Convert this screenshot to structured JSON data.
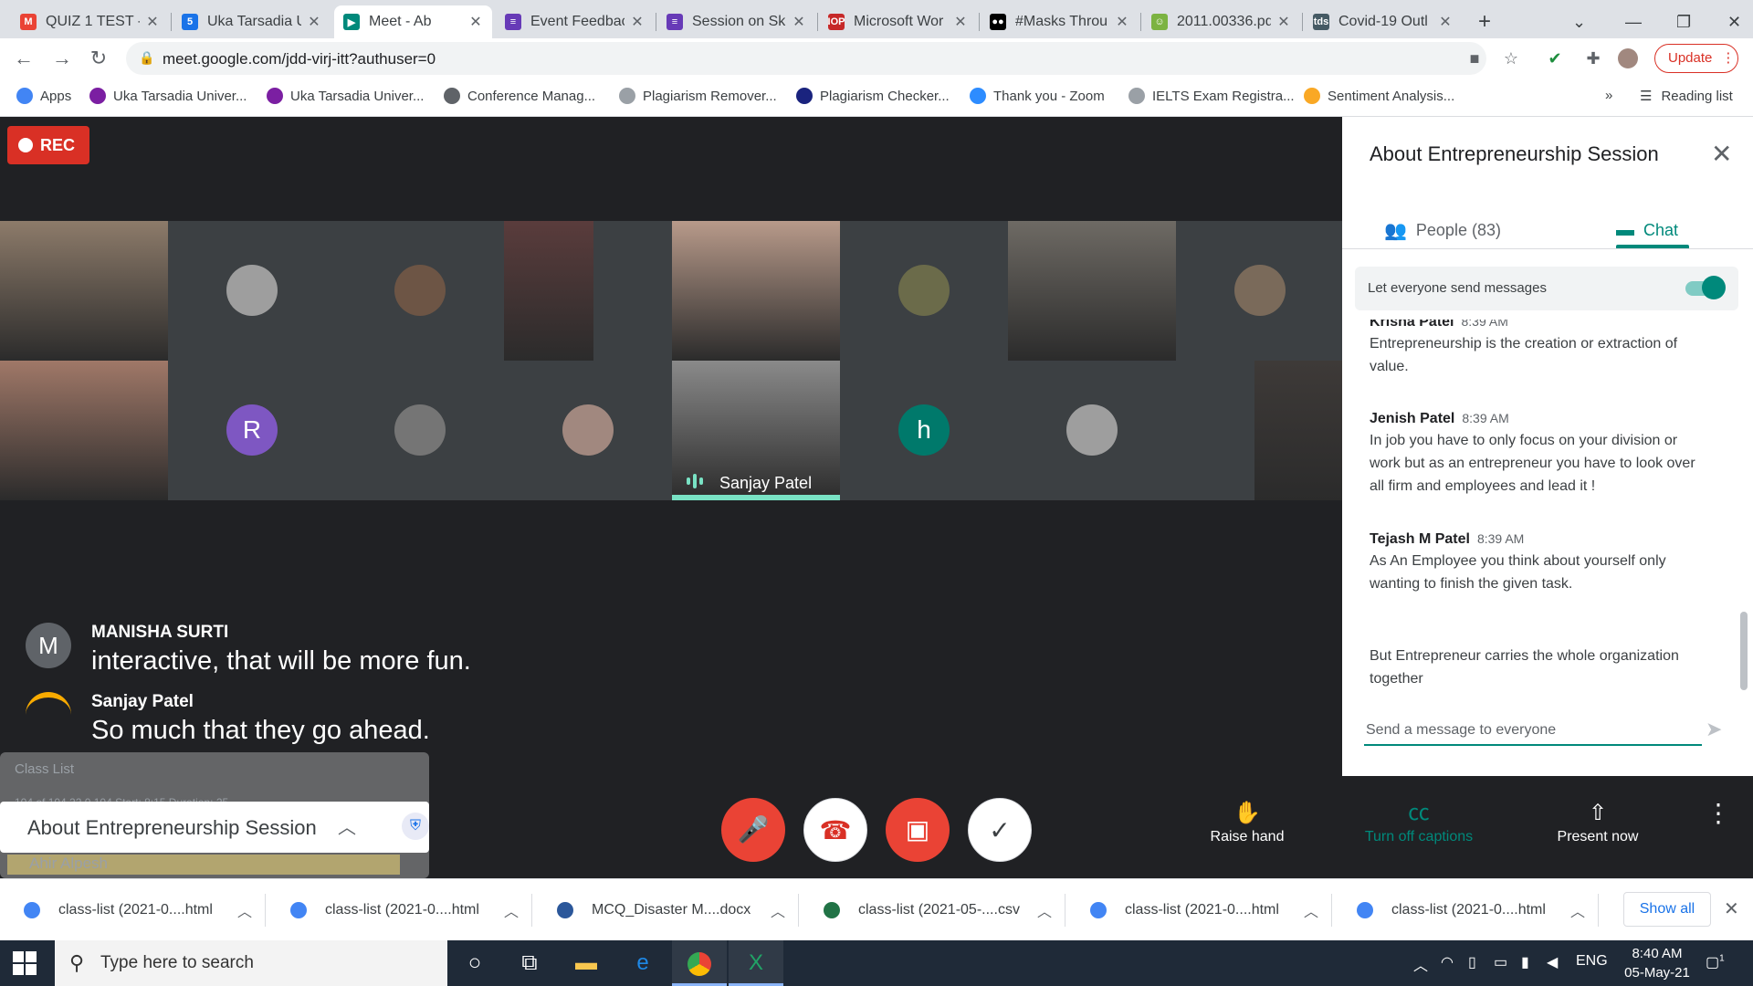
{
  "browser": {
    "tabs": [
      {
        "label": "QUIZ 1 TEST -",
        "icon": "gmail-icon",
        "color": "#ea4335",
        "glyph": "M"
      },
      {
        "label": "Uka Tarsadia U",
        "icon": "calendar-icon",
        "color": "#1a73e8",
        "glyph": "5"
      },
      {
        "label": "Meet - Ab",
        "icon": "meet-icon",
        "color": "#00897b",
        "glyph": "▶",
        "active": true
      },
      {
        "label": "Event Feedbac",
        "icon": "forms-icon",
        "color": "#673ab7",
        "glyph": "≡"
      },
      {
        "label": "Session on Ski",
        "icon": "forms-icon",
        "color": "#673ab7",
        "glyph": "≡"
      },
      {
        "label": "Microsoft Wor",
        "icon": "iop-icon",
        "color": "#c62828",
        "glyph": "IOP"
      },
      {
        "label": "#Masks Throu",
        "icon": "medium-icon",
        "color": "#000000",
        "glyph": "●●"
      },
      {
        "label": "2011.00336.pd",
        "icon": "smiley-icon",
        "color": "#7cb342",
        "glyph": "☺"
      },
      {
        "label": "Covid-19 Outl",
        "icon": "tds-icon",
        "color": "#455a64",
        "glyph": "tds"
      }
    ],
    "url": "meet.google.com/jdd-virj-itt?authuser=0",
    "update_label": "Update",
    "bookmarks": [
      {
        "label": "Apps",
        "color": "#4285f4"
      },
      {
        "label": "Uka Tarsadia Univer...",
        "color": "#7b1fa2"
      },
      {
        "label": "Uka Tarsadia Univer...",
        "color": "#7b1fa2"
      },
      {
        "label": "Conference Manag...",
        "color": "#5f6368"
      },
      {
        "label": "Plagiarism Remover...",
        "color": "#9aa0a6"
      },
      {
        "label": "Plagiarism Checker...",
        "color": "#1a237e"
      },
      {
        "label": "Thank you - Zoom",
        "color": "#2d8cff"
      },
      {
        "label": "IELTS Exam Registra...",
        "color": "#9aa0a6"
      },
      {
        "label": "Sentiment Analysis...",
        "color": "#f9a825"
      }
    ],
    "overflow_label": "»",
    "reading_list_label": "Reading list"
  },
  "meet": {
    "rec_label": "REC",
    "participants": [
      {
        "type": "video",
        "color": "#8d7b6a"
      },
      {
        "type": "avatar",
        "color": "#9e9e9e",
        "letter": ""
      },
      {
        "type": "avatar",
        "color": "#6d5545",
        "letter": ""
      },
      {
        "type": "video",
        "color": "#5a3c3c"
      },
      {
        "type": "video",
        "color": "#b89a8a"
      },
      {
        "type": "avatar",
        "color": "#6b6b4a",
        "letter": ""
      },
      {
        "type": "video",
        "color": "#6e6a64"
      },
      {
        "type": "avatar",
        "color": "#7a6a5a",
        "letter": ""
      },
      {
        "type": "video",
        "color": "#a07868"
      },
      {
        "type": "avatar",
        "color": "#7e57c2",
        "letter": "R"
      },
      {
        "type": "avatar",
        "color": "#757575",
        "letter": ""
      },
      {
        "type": "avatar",
        "color": "#a1887f",
        "letter": ""
      },
      {
        "type": "video",
        "color": "#8a8a8a",
        "name": "Sanjay Patel",
        "speaking": true
      },
      {
        "type": "avatar",
        "color": "#00796b",
        "letter": "h"
      },
      {
        "type": "avatar",
        "color": "#9e9e9e",
        "letter": ""
      },
      {
        "type": "video",
        "color": "#3e3a38"
      }
    ],
    "captions": [
      {
        "avatar_letter": "M",
        "name": "MANISHA SURTI",
        "text": "interactive, that will be more fun."
      },
      {
        "avatar_letter": "",
        "name": "Sanjay Patel",
        "text": "So much that they go ahead."
      }
    ],
    "class_list": {
      "title": "Class List",
      "stats": "104 of 104   22   0   104  Start: 8:15  Duration: 25",
      "row": "Ahir Alpesh"
    },
    "meeting_title": "About Entrepreneurship Session",
    "controls": {
      "raise_hand": "Raise hand",
      "captions": "Turn off captions",
      "present": "Present now"
    }
  },
  "panel": {
    "title": "About Entrepreneurship Session",
    "people_label": "People (83)",
    "chat_label": "Chat",
    "toggle_label": "Let everyone send messages",
    "toggle_on": true,
    "messages": [
      {
        "name": "Krisna Patel",
        "time": "8:39 AM",
        "text": "Entrepreneurship is the creation or extraction of value."
      },
      {
        "name": "Jenish Patel",
        "time": "8:39 AM",
        "text": "In job you have to only focus on your division or work but as an entrepreneur you have to look over all firm and employees and lead it !"
      },
      {
        "name": "Tejash M Patel",
        "time": "8:39 AM",
        "text": "As An Employee you think about yourself only wanting to finish the given task."
      },
      {
        "name": "",
        "time": "",
        "text": "But Entrepreneur carries the whole organization together"
      }
    ],
    "input_placeholder": "Send a message to everyone"
  },
  "downloads": {
    "items": [
      {
        "label": "class-list (2021-0....html",
        "icon": "chrome-icon",
        "color": "#4285f4"
      },
      {
        "label": "class-list (2021-0....html",
        "icon": "chrome-icon",
        "color": "#4285f4"
      },
      {
        "label": "MCQ_Disaster M....docx",
        "icon": "word-icon",
        "color": "#2b579a"
      },
      {
        "label": "class-list (2021-05-....csv",
        "icon": "excel-icon",
        "color": "#217346"
      },
      {
        "label": "class-list (2021-0....html",
        "icon": "chrome-icon",
        "color": "#4285f4"
      },
      {
        "label": "class-list (2021-0....html",
        "icon": "chrome-icon",
        "color": "#4285f4"
      }
    ],
    "show_all": "Show all"
  },
  "taskbar": {
    "search_placeholder": "Type here to search",
    "lang": "ENG",
    "time": "8:40 AM",
    "date": "05-May-21",
    "notif_count": "1"
  }
}
